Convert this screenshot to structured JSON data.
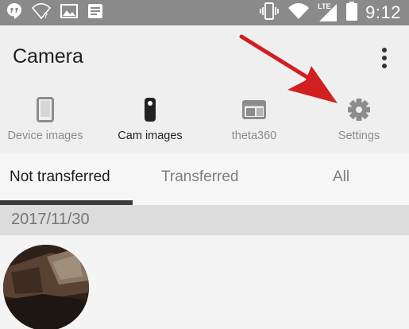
{
  "status_bar": {
    "time": "9:12",
    "network_label": "LTE",
    "icons": [
      "hangouts-icon",
      "wifi-question-icon",
      "image-icon",
      "notes-icon",
      "vibrate-icon",
      "wifi-icon",
      "signal-icon",
      "battery-icon"
    ]
  },
  "app_bar": {
    "title": "Camera",
    "overflow_icon": "more-vert-icon"
  },
  "sources": [
    {
      "label": "Device images",
      "icon": "phone-icon",
      "active": false
    },
    {
      "label": "Cam images",
      "icon": "camera-device-icon",
      "active": true
    },
    {
      "label": "theta360",
      "icon": "web-window-icon",
      "active": false
    },
    {
      "label": "Settings",
      "icon": "gear-icon",
      "active": false
    }
  ],
  "transfer_tabs": [
    {
      "label": "Not transferred",
      "active": true
    },
    {
      "label": "Transferred",
      "active": false
    },
    {
      "label": "All",
      "active": false
    }
  ],
  "date_header": "2017/11/30",
  "colors": {
    "annotation_arrow": "#d21f1f",
    "status_bar": "#8a8a8a",
    "tab_indicator": "#3b3b3b"
  }
}
